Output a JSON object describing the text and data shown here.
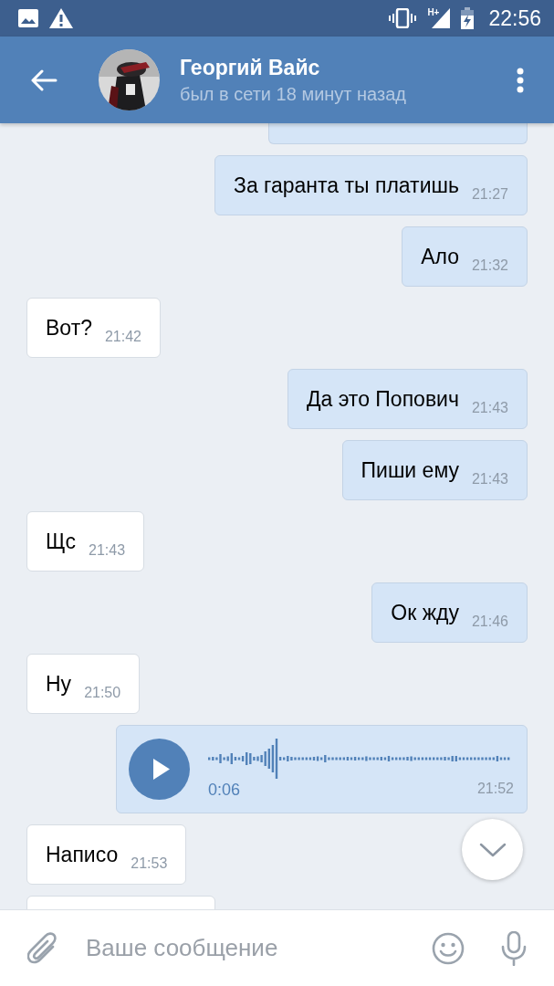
{
  "status_bar": {
    "network": "H+",
    "time": "22:56"
  },
  "header": {
    "name": "Георгий Вайс",
    "status": "был в сети 18 минут назад"
  },
  "messages": [
    {
      "kind": "text",
      "outgoing": true,
      "text": "За гаранта ты платишь",
      "time": "21:27"
    },
    {
      "kind": "text",
      "outgoing": true,
      "text": "Ало",
      "time": "21:32"
    },
    {
      "kind": "text",
      "outgoing": false,
      "text": "Вот?",
      "time": "21:42"
    },
    {
      "kind": "text",
      "outgoing": true,
      "text": "Да это Попович",
      "time": "21:43"
    },
    {
      "kind": "text",
      "outgoing": true,
      "text": "Пиши ему",
      "time": "21:43"
    },
    {
      "kind": "text",
      "outgoing": false,
      "text": "Щс",
      "time": "21:43"
    },
    {
      "kind": "text",
      "outgoing": true,
      "text": "Ок жду",
      "time": "21:46"
    },
    {
      "kind": "text",
      "outgoing": false,
      "text": "Ну",
      "time": "21:50"
    },
    {
      "kind": "voice",
      "outgoing": true,
      "duration": "0:06",
      "time": "21:52"
    },
    {
      "kind": "text",
      "outgoing": false,
      "text": "Написо",
      "time": "21:53"
    }
  ],
  "composer": {
    "placeholder": "Ваше сообщение"
  }
}
